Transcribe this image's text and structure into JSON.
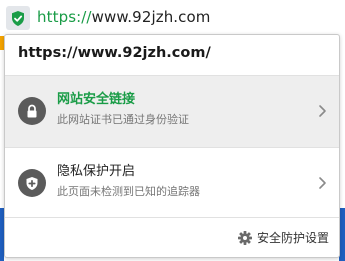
{
  "address_bar": {
    "scheme": "https://",
    "host": "www.92jzh.com",
    "shield_icon": "shield-check-icon",
    "accent": "#1a9c47"
  },
  "popup": {
    "url": "https://www.92jzh.com/",
    "secure_connection": {
      "title": "网站安全链接",
      "subtitle": "此网站证书已通过身份验证",
      "icon": "lock-icon",
      "title_color": "#1a9c47"
    },
    "privacy": {
      "title": "隐私保护开启",
      "subtitle": "此页面未检测到已知的追踪器",
      "icon": "shield-plus-icon"
    },
    "footer": {
      "settings_label": "安全防护设置",
      "icon": "gear-icon"
    }
  }
}
